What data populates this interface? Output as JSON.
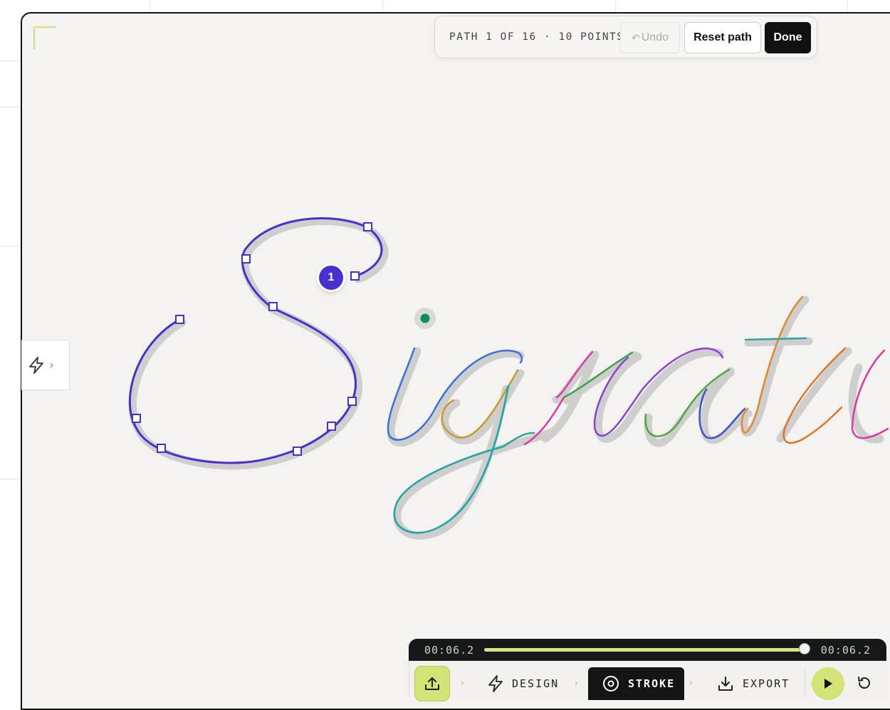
{
  "toolbar": {
    "path_info": "PATH 1 OF 16 · 10 POINTS",
    "undo_label": "Undo",
    "reset_label": "Reset path",
    "done_label": "Done"
  },
  "canvas": {
    "path_marker": "1",
    "accent_color": "#4a2fd0"
  },
  "timeline": {
    "current_time": "00:06.2",
    "total_time": "00:06.2",
    "progress": 1.0
  },
  "steps": {
    "design_label": "DESIGN",
    "stroke_label": "STROKE",
    "export_label": "EXPORT",
    "active": "STROKE"
  },
  "icons": {
    "side_tab": "lightning-icon",
    "upload": "upload-icon",
    "design": "lightning-icon",
    "stroke": "target-icon",
    "export": "download-icon",
    "play": "play-icon",
    "replay": "replay-icon"
  }
}
